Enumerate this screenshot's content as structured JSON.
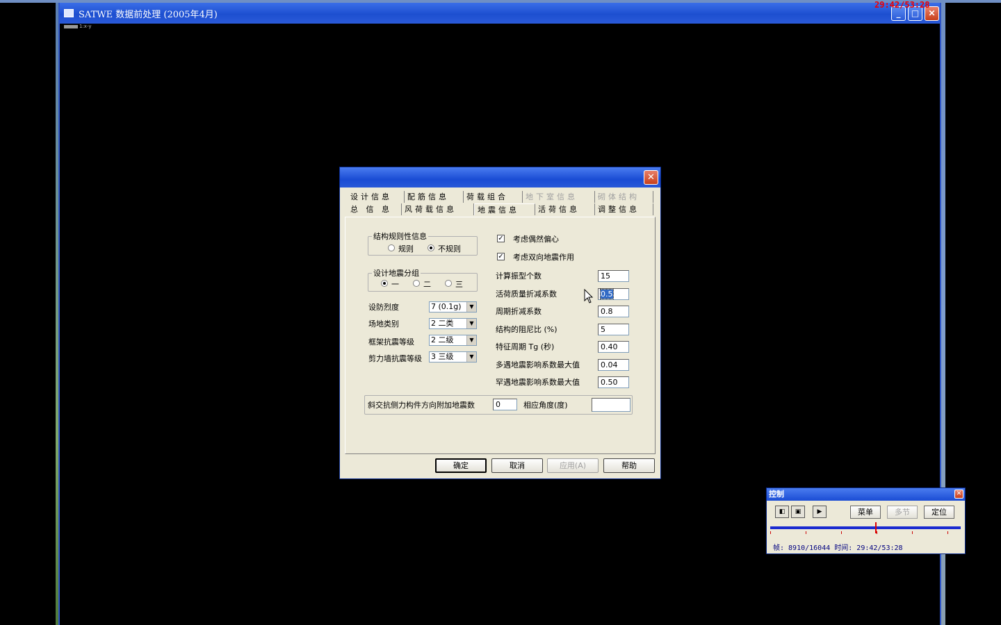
{
  "main_window": {
    "title": "SATWE 数据前处理 (2005年4月)",
    "ruler_text": "1:x-y",
    "controls": {
      "minimize": "_",
      "maximize": "□",
      "close": "✕"
    }
  },
  "overlay_timestamp": "29:42/53:28",
  "dialog": {
    "close_label": "✕",
    "tabs_row1": [
      {
        "label": "设计信息",
        "disabled": false
      },
      {
        "label": "配筋信息",
        "disabled": false
      },
      {
        "label": "荷载组合",
        "disabled": false
      },
      {
        "label": "地下室信息",
        "disabled": true
      },
      {
        "label": "砌体结构",
        "disabled": true
      }
    ],
    "tabs_row2": [
      {
        "label": "总 信 息",
        "active": false
      },
      {
        "label": "风荷载信息",
        "active": false
      },
      {
        "label": "地震信息",
        "active": true
      },
      {
        "label": "活荷信息",
        "active": false
      },
      {
        "label": "调整信息",
        "active": false
      }
    ],
    "regularity": {
      "title": "结构规则性信息",
      "options": [
        "规则",
        "不规则"
      ],
      "selected": "不规则"
    },
    "seismic_group": {
      "title": "设计地震分组",
      "options": [
        "一",
        "二",
        "三"
      ],
      "selected": "一"
    },
    "combos": [
      {
        "label": "设防烈度",
        "value": "7 (0.1g)"
      },
      {
        "label": "场地类别",
        "value": "2 二类"
      },
      {
        "label": "框架抗震等级",
        "value": "2 二级"
      },
      {
        "label": "剪力墙抗震等级",
        "value": "3 三级"
      }
    ],
    "checkboxes": [
      {
        "label": "考虑偶然偏心",
        "checked": true
      },
      {
        "label": "考虑双向地震作用",
        "checked": true
      }
    ],
    "fields": [
      {
        "label": "计算振型个数",
        "value": "15"
      },
      {
        "label": "活荷质量折减系数",
        "value": "0.5",
        "selected": true
      },
      {
        "label": "周期折减系数",
        "value": "0.8"
      },
      {
        "label": "结构的阻尼比 (%)",
        "value": "5"
      },
      {
        "label": "特征周期 Tg (秒)",
        "value": "0.40"
      },
      {
        "label": "多遇地震影响系数最大值",
        "value": "0.04"
      },
      {
        "label": "罕遇地震影响系数最大值",
        "value": "0.50"
      }
    ],
    "oblique": {
      "label": "斜交抗侧力构件方向附加地震数",
      "value": "0",
      "angle_label": "相应角度(度)",
      "angle_value": ""
    },
    "buttons": {
      "ok": "确定",
      "cancel": "取消",
      "apply": "应用(A)",
      "help": "帮助"
    }
  },
  "control_panel": {
    "title": "控制",
    "close_label": "✕",
    "icons": [
      "prev-frame-icon",
      "stop-icon",
      "next-frame-icon"
    ],
    "buttons": {
      "menu": "菜单",
      "multi": "多节",
      "locate": "定位"
    },
    "progress": 0.555,
    "status": "帧: 8910/16044 时间: 29:42/53:28"
  }
}
